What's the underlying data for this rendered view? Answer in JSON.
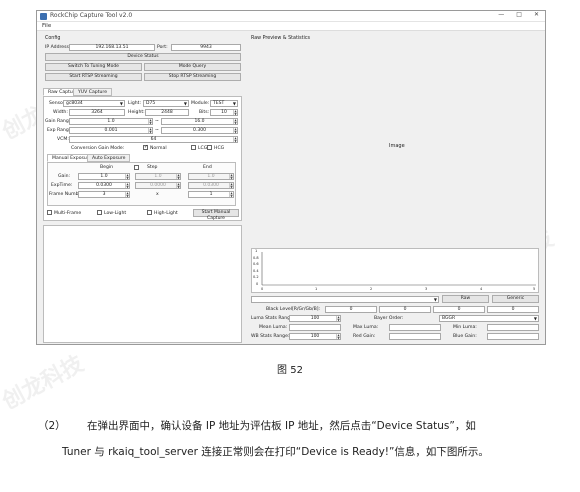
{
  "window": {
    "title": "RockChip Capture Tool v2.0",
    "menu": "File",
    "controls": [
      "—",
      "□",
      "✕"
    ]
  },
  "config": {
    "section": "Config",
    "ip_label": "IP Address:",
    "ip_value": "192.168.13.51",
    "port_label": "Port:",
    "port_value": "9943",
    "device_status": "Device Status",
    "switch_tuning": "Switch To Tuning Mode",
    "mode_query": "Mode Query",
    "start_rtsp": "Start RTSP Streaming",
    "stop_rtsp": "Stop RTSP Streaming"
  },
  "tabs": {
    "raw": "Raw Capture",
    "yuv": "YUV Capture"
  },
  "raw": {
    "sensor_label": "Sensor:",
    "sensor_value": "gc8034",
    "light_label": "Light:",
    "light_value": "D75",
    "module_label": "Module:",
    "module_value": "TEST",
    "width_label": "Width:",
    "width_value": "3264",
    "height_label": "Height:",
    "height_value": "2448",
    "bits_label": "Bits:",
    "bits_value": "10",
    "gain_range_label": "Gain Range:",
    "gain_min": "1.0",
    "gain_max": "16.0",
    "exp_range_label": "Exp Range:",
    "exp_min": "0.001",
    "exp_max": "0.300",
    "vcm_label": "VCM:",
    "vcm_value": "64",
    "conv_gain_label": "Conversion Gain Mode:",
    "normal": "Normal",
    "lcg": "LCG",
    "hcg": "HCG",
    "tilde": "~"
  },
  "exposure_tabs": {
    "manual": "Manual Exposure",
    "auto": "Auto Exposure"
  },
  "manual": {
    "col_begin": "Begin",
    "col_step": "Step",
    "col_end": "End",
    "gain_label": "Gain:",
    "gain_begin": "1.0",
    "gain_step": "1.0",
    "gain_end": "1.0",
    "exptime_label": "ExpTime:",
    "exptime_begin": "0.0300",
    "exptime_step": "0.0000",
    "exptime_end": "0.0300",
    "frame_label": "Frame Number:",
    "frame_begin": "3",
    "frame_x": "x",
    "frame_end": "1"
  },
  "options": {
    "multi_frame": "Multi-Frame",
    "low_light": "Low-Light",
    "high_light": "High-Light",
    "start_manual": "Start Manual Capture"
  },
  "preview": {
    "section": "Raw Preview & Statistics",
    "image_label": "Image",
    "y_ticks": [
      "1",
      "0.8",
      "0.6",
      "0.4",
      "0.2",
      "0"
    ],
    "x_ticks": [
      "0",
      "1",
      "2",
      "3",
      "4",
      "5"
    ]
  },
  "stats": {
    "raw_btn": "Raw",
    "generic_btn": "Generic",
    "black_level_label": "Black Level[R/Gr/Gb/B]:",
    "black_levels": [
      "0",
      "0",
      "0",
      "0"
    ],
    "luma_range_label": "Luma Stats Range:",
    "luma_range_value": "100",
    "bayer_label": "Bayer Order:",
    "bayer_value": "BGGR",
    "mean_luma": "Mean Luma:",
    "max_luma": "Max Luma:",
    "min_luma": "Min Luma:",
    "wb_range_label": "WB Stats Range:",
    "wb_range_value": "100",
    "rgain": "Red Gain:",
    "bgain": "Blue Gain:"
  },
  "watermark": "创龙科技",
  "caption": "图 52",
  "paragraph": {
    "number": "（2）",
    "line1": "在弹出界面中，确认设备 IP 地址为评估板 IP 地址，然后点击“Device Status”，如",
    "line2": "Tuner 与 rkaiq_tool_server 连接正常则会在打印“Device is Ready!”信息，如下图所示。"
  }
}
